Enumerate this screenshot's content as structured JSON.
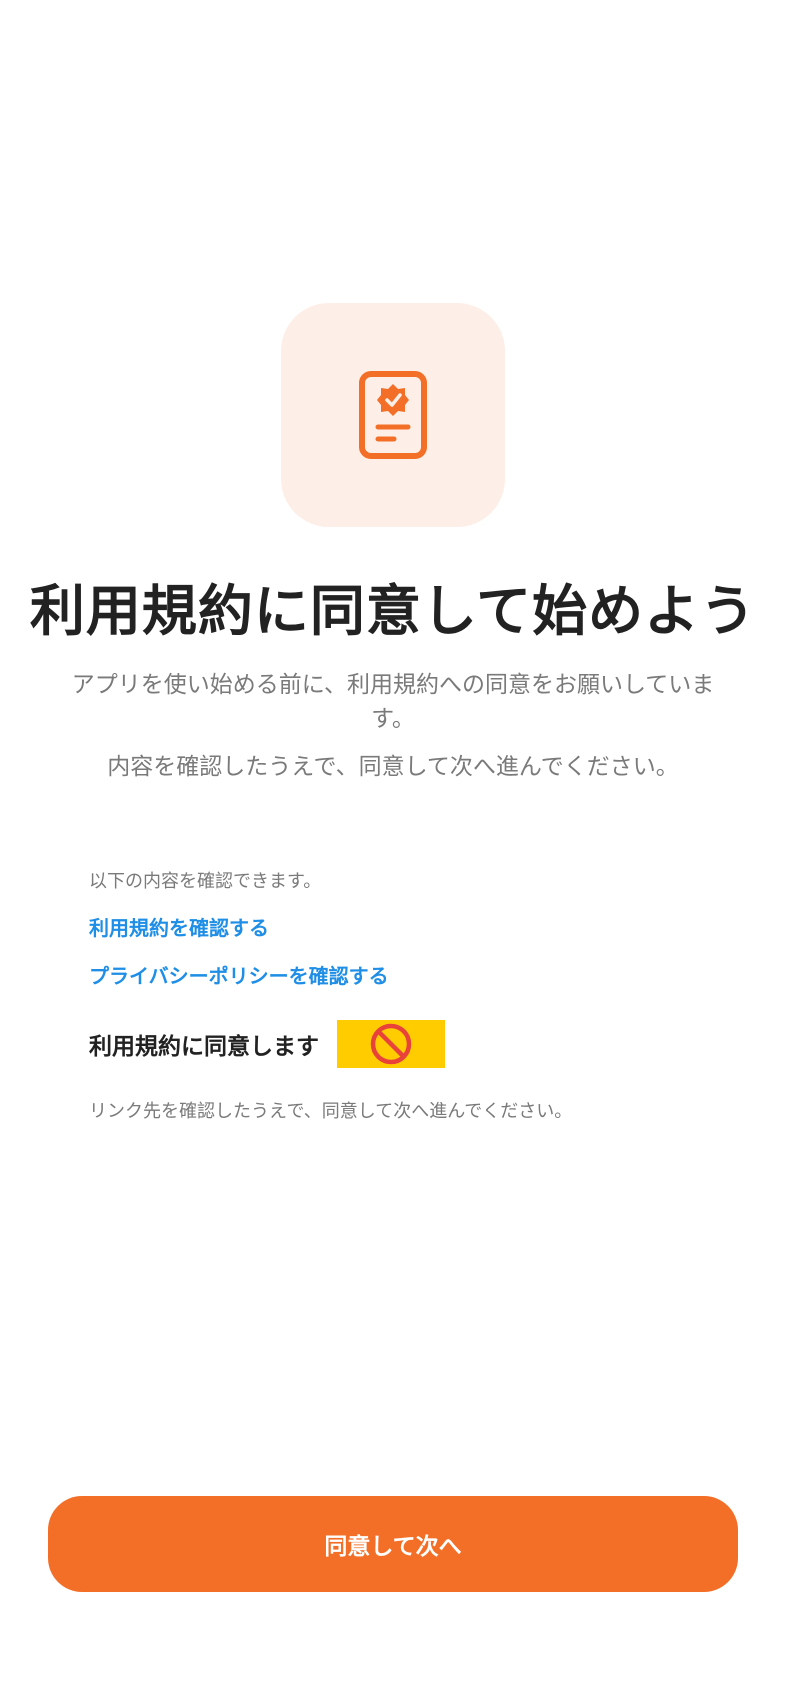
{
  "header": {
    "icon": "document-badge-check-icon",
    "accent_color": "#f36f27",
    "tile_color": "#fdefe7"
  },
  "main": {
    "title": "利用規約に同意して始めよう",
    "subtitle": "アプリを使い始める前に、利用規約への同意をお願いしています。",
    "subtitle2": "内容を確認したうえで、同意して次へ進んでください。"
  },
  "links": {
    "intro": "以下の内容を確認できます。",
    "terms_label": "利用規約を確認する",
    "privacy_label": "プライバシーポリシーを確認する"
  },
  "agreement": {
    "label": "利用規約に同意します",
    "control_icon": "prohibited-icon",
    "control_color": "#ffcc00",
    "note": "リンク先を確認したうえで、同意して次へ進んでください。"
  },
  "footer": {
    "button_label": "同意して次へ",
    "button_color": "#f36f27"
  }
}
